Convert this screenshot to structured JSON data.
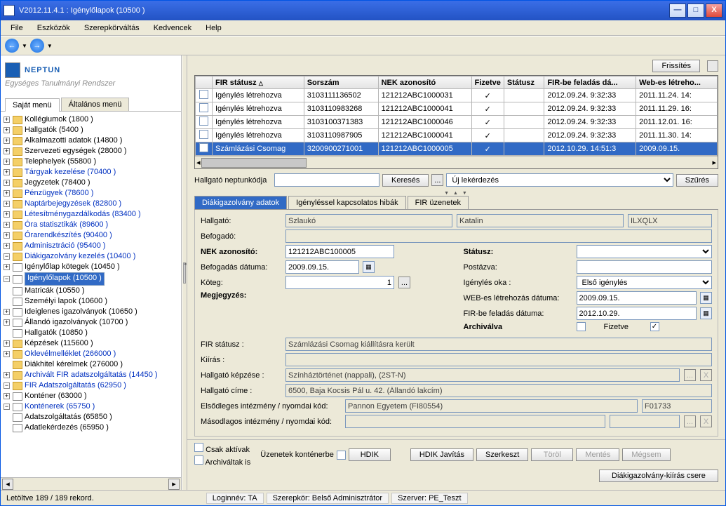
{
  "title": "V2012.11.4.1 : Igénylőlapok (10500  )",
  "menu": [
    "File",
    "Eszközök",
    "Szerepkörváltás",
    "Kedvencek",
    "Help"
  ],
  "logo": {
    "brand": "NEPTUN",
    "tagline": "Egységes Tanulmányi Rendszer"
  },
  "leftTabs": {
    "own": "Saját menü",
    "gen": "Általános menü"
  },
  "tree": [
    {
      "t": "Kollégiumok (1800  )",
      "pm": "+",
      "ind": 0
    },
    {
      "t": "Hallgatók (5400  )",
      "pm": "+",
      "ind": 0
    },
    {
      "t": "Alkalmazotti adatok (14800  )",
      "pm": "+",
      "ind": 0
    },
    {
      "t": "Szervezeti egységek (28000  )",
      "pm": "+",
      "ind": 0
    },
    {
      "t": "Telephelyek (55800  )",
      "pm": "+",
      "ind": 0
    },
    {
      "t": "Tárgyak kezelése (70400  )",
      "pm": "+",
      "ind": 0,
      "link": true
    },
    {
      "t": "Jegyzetek (78400  )",
      "pm": "+",
      "ind": 0
    },
    {
      "t": "Pénzügyek (78600  )",
      "pm": "+",
      "ind": 0,
      "link": true
    },
    {
      "t": "Naptárbejegyzések (82800  )",
      "pm": "+",
      "ind": 0,
      "link": true
    },
    {
      "t": "Létesítménygazdálkodás (83400  )",
      "pm": "+",
      "ind": 0,
      "link": true
    },
    {
      "t": "Óra statisztikák  (89600  )",
      "pm": "+",
      "ind": 0,
      "link": true
    },
    {
      "t": "Órarendkészítés (90400  )",
      "pm": "+",
      "ind": 0,
      "link": true
    },
    {
      "t": "Adminisztráció (95400  )",
      "pm": "+",
      "ind": 0,
      "link": true
    },
    {
      "t": "Diákigazolvány kezelés (10400  )",
      "pm": "−",
      "ind": 0,
      "link": true
    },
    {
      "t": "Igénylőlap kötegek (10450  )",
      "pm": "+",
      "ind": 1,
      "doc": true
    },
    {
      "t": "Igénylőlapok (10500  )",
      "pm": "−",
      "ind": 1,
      "doc": true,
      "sel": true
    },
    {
      "t": "Matricák (10550  )",
      "pm": "",
      "ind": 2,
      "doc": true
    },
    {
      "t": "Személyi lapok  (10600  )",
      "pm": "",
      "ind": 2,
      "doc": true
    },
    {
      "t": "Ideiglenes igazolványok (10650  )",
      "pm": "+",
      "ind": 2,
      "doc": true
    },
    {
      "t": "Állandó igazolványok (10700  )",
      "pm": "+",
      "ind": 2,
      "doc": true
    },
    {
      "t": "Hallgatók (10850  )",
      "pm": "",
      "ind": 2,
      "doc": true
    },
    {
      "t": "Képzések  (115600  )",
      "pm": "+",
      "ind": 0
    },
    {
      "t": "Oklevélmelléklet (266000  )",
      "pm": "+",
      "ind": 0,
      "link": true
    },
    {
      "t": "Diákhitel kérelmek (276000  )",
      "pm": "",
      "ind": 0
    },
    {
      "t": "Archivált FIR adatszolgáltatás (14450  )",
      "pm": "+",
      "ind": 0,
      "link": true
    },
    {
      "t": "FIR Adatszolgáltatás (62950  )",
      "pm": "−",
      "ind": 0,
      "link": true
    },
    {
      "t": "Konténer (63000  )",
      "pm": "+",
      "ind": 1,
      "doc": true
    },
    {
      "t": "Konténerek (65750  )",
      "pm": "−",
      "ind": 1,
      "doc": true,
      "link": true
    },
    {
      "t": "Adatszolgáltatás (65850  )",
      "pm": "",
      "ind": 2,
      "doc": true
    },
    {
      "t": "Adatlekérdezés (65950  )",
      "pm": "",
      "ind": 2,
      "doc": true
    }
  ],
  "toprow": {
    "refresh": "Frissítés"
  },
  "gridCols": [
    "",
    "FIR státusz",
    "Sorszám",
    "NEK azonosító",
    "Fizetve",
    "Státusz",
    "FIR-be feladás dá...",
    "Web-es létreho..."
  ],
  "gridRows": [
    {
      "c": [
        "",
        "Igénylés létrehozva",
        "3103111136502",
        "121212ABC1000031",
        "✓",
        "",
        "2012.09.24. 9:32:33",
        "2011.11.24. 14:"
      ]
    },
    {
      "c": [
        "",
        "Igénylés létrehozva",
        "3103110983268",
        "121212ABC1000041",
        "✓",
        "",
        "2012.09.24. 9:32:33",
        "2011.11.29. 16:"
      ]
    },
    {
      "c": [
        "",
        "Igénylés létrehozva",
        "3103100371383",
        "121212ABC1000046",
        "✓",
        "",
        "2012.09.24. 9:32:33",
        "2011.12.01. 16:"
      ]
    },
    {
      "c": [
        "",
        "Igénylés létrehozva",
        "3103110987905",
        "121212ABC1000041",
        "✓",
        "",
        "2012.09.24. 9:32:33",
        "2011.11.30. 14:"
      ]
    },
    {
      "c": [
        "",
        "Számlázási Csomag",
        "3200900271001",
        "121212ABC1000005",
        "✓",
        "",
        "2012.10.29. 14:51:3",
        "2009.09.15."
      ],
      "sel": true
    }
  ],
  "search": {
    "label": "Hallgató neptunkódja",
    "btnSearch": "Keresés",
    "dots": "...",
    "query": "Új lekérdezés",
    "filter": "Szűrés"
  },
  "detTabs": [
    "Diákigazolvány adatok",
    "Igényléssel kapcsolatos hibák",
    "FIR üzenetek"
  ],
  "detail": {
    "studentLbl": "Hallgató:",
    "studentLast": "Szlaukó",
    "studentFirst": "Katalin",
    "studentCode": "ILXQLX",
    "recvLbl": "Befogadó:",
    "nekLbl": "NEK azonosító:",
    "nek": "121212ABC100005",
    "recvDateLbl": "Befogadás dátuma:",
    "recvDate": "2009.09.15.",
    "batchLbl": "Köteg:",
    "batch": "1",
    "noteLbl": "Megjegyzés:",
    "statusLbl": "Státusz:",
    "postedLbl": "Postázva:",
    "reasonLbl": "Igénylés oka :",
    "reason": "Első igénylés",
    "webLbl": "WEB-es létrehozás dátuma:",
    "webDate": "2009.09.15.",
    "firDateLbl": "FIR-be feladás dátuma:",
    "firDate": "2012.10.29.",
    "archLbl": "Archiválva",
    "paidLbl": "Fizetve",
    "firStatusLbl": "FIR státusz :",
    "firStatus": "Számlázási Csomag kiállításra került",
    "printLbl": "Kiírás :",
    "eduLbl": "Hallgató képzése :",
    "edu": "Színháztörténet (nappali), (2ST-N)",
    "addrLbl": "Hallgató címe :",
    "addr": "6500, Baja Kocsis Pál u. 42. (Állandó lakcím)",
    "inst1Lbl": "Elsődleges intézmény / nyomdai kód:",
    "inst1": "Pannon Egyetem (FI80554)",
    "inst1code": "F01733",
    "inst2Lbl": "Másodlagos intézmény / nyomdai kód:"
  },
  "bottom": {
    "onlyActive": "Csak aktívak",
    "archived": "Archiváltak is",
    "msgCont": "Üzenetek konténerbe",
    "hdik": "HDIK",
    "hdikFix": "HDIK Javítás",
    "edit": "Szerkeszt",
    "del": "Töröl",
    "save": "Mentés",
    "cancel": "Mégsem",
    "swap": "Diákigazolvány-kiírás csere"
  },
  "status": {
    "left": "Letöltve 189 / 189 rekord.",
    "login": "Loginnév: TA",
    "role": "Szerepkör: Belső Adminisztrátor",
    "server": "Szerver: PE_Teszt"
  }
}
